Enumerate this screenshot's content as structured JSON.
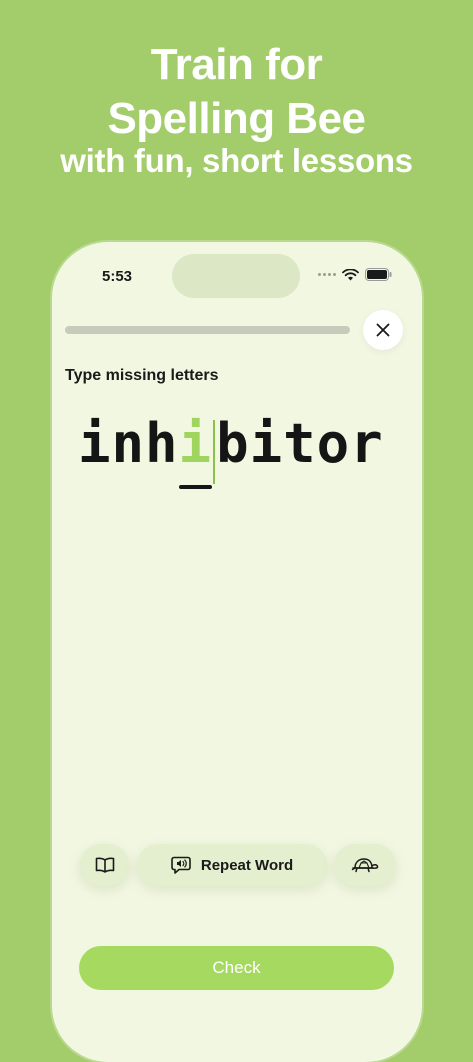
{
  "headline": {
    "line1": "Train for",
    "line2": "Spelling Bee",
    "line3": "with fun, short lessons"
  },
  "status_bar": {
    "time": "5:53",
    "icons": [
      "signal-dots-icon",
      "wifi-icon",
      "battery-icon"
    ]
  },
  "lesson": {
    "progress_fraction": 0.0,
    "instruction": "Type missing letters",
    "word_prefix": "inh",
    "missing_letter": "i",
    "word_suffix": "bitor"
  },
  "actions": {
    "dictionary_icon": "book-icon",
    "repeat_icon": "speaker-bubble-icon",
    "repeat_label": "Repeat Word",
    "slow_icon": "turtle-icon"
  },
  "check_label": "Check",
  "colors": {
    "background": "#a3cc6b",
    "phone_screen": "#f2f7e2",
    "accent_green": "#a6d95f",
    "missing_letter": "#9fd45f"
  }
}
